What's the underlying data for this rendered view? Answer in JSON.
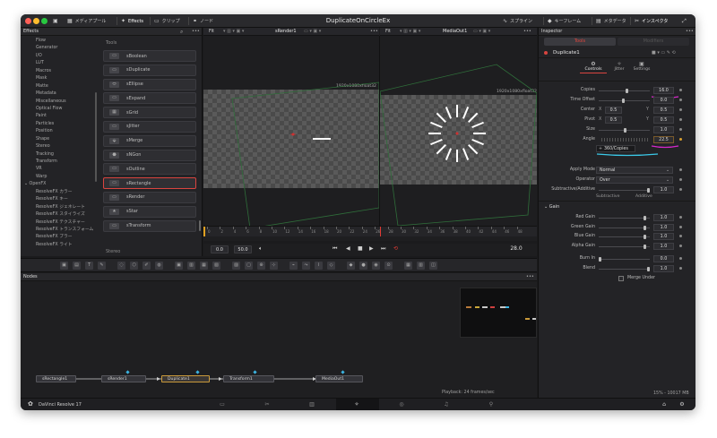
{
  "titlebar": {
    "title": "DuplicateOnCircleEx",
    "left_buttons": [
      {
        "label": "メディアプール",
        "icon": "media-pool-icon"
      },
      {
        "label": "Effects",
        "icon": "effects-icon"
      },
      {
        "label": "クリップ",
        "icon": "clips-icon"
      },
      {
        "label": "ノード",
        "icon": "nodes-icon"
      }
    ],
    "right_buttons": [
      {
        "label": "スプライン",
        "icon": "spline-icon"
      },
      {
        "label": "キーフレーム",
        "icon": "keyframe-icon"
      },
      {
        "label": "メタデータ",
        "icon": "metadata-icon"
      },
      {
        "label": "インスペクタ",
        "icon": "inspector-icon"
      }
    ]
  },
  "effects": {
    "title": "Effects",
    "tree": [
      {
        "label": "Flow",
        "kind": "item"
      },
      {
        "label": "Generator",
        "kind": "item"
      },
      {
        "label": "I/O",
        "kind": "item"
      },
      {
        "label": "LUT",
        "kind": "item"
      },
      {
        "label": "Macros",
        "kind": "item"
      },
      {
        "label": "Mask",
        "kind": "item"
      },
      {
        "label": "Matte",
        "kind": "item"
      },
      {
        "label": "Metadata",
        "kind": "item"
      },
      {
        "label": "Miscellaneous",
        "kind": "item"
      },
      {
        "label": "Optical Flow",
        "kind": "item"
      },
      {
        "label": "Paint",
        "kind": "item"
      },
      {
        "label": "Particles",
        "kind": "item"
      },
      {
        "label": "Position",
        "kind": "item"
      },
      {
        "label": "Shape",
        "kind": "item"
      },
      {
        "label": "Stereo",
        "kind": "item"
      },
      {
        "label": "Tracking",
        "kind": "item"
      },
      {
        "label": "Transform",
        "kind": "item"
      },
      {
        "label": "VR",
        "kind": "item"
      },
      {
        "label": "Warp",
        "kind": "item"
      },
      {
        "label": "OpenFX",
        "kind": "group"
      },
      {
        "label": "ResolveFX カラー",
        "kind": "sub"
      },
      {
        "label": "ResolveFX キー",
        "kind": "sub"
      },
      {
        "label": "ResolveFX ジェネレート",
        "kind": "sub"
      },
      {
        "label": "ResolveFX スタイライズ",
        "kind": "sub"
      },
      {
        "label": "ResolveFX テクスチャー",
        "kind": "sub"
      },
      {
        "label": "ResolveFX トランスフォーム",
        "kind": "sub"
      },
      {
        "label": "ResolveFX ブラー",
        "kind": "sub"
      },
      {
        "label": "ResolveFX ライト",
        "kind": "sub"
      }
    ],
    "tools_label": "Tools",
    "tools": [
      {
        "label": "sBoolean",
        "selected": false
      },
      {
        "label": "sDuplicate",
        "selected": false
      },
      {
        "label": "sEllipse",
        "selected": false
      },
      {
        "label": "sExpand",
        "selected": false
      },
      {
        "label": "sGrid",
        "selected": false
      },
      {
        "label": "sJitter",
        "selected": false
      },
      {
        "label": "sMerge",
        "selected": false
      },
      {
        "label": "sNGon",
        "selected": false
      },
      {
        "label": "sOutline",
        "selected": false
      },
      {
        "label": "sRectangle",
        "selected": true
      },
      {
        "label": "sRender",
        "selected": false
      },
      {
        "label": "sStar",
        "selected": false
      },
      {
        "label": "sTransform",
        "selected": false
      }
    ],
    "stereo_label": "Stereo"
  },
  "viewers": {
    "left": {
      "fit": "Fit",
      "name": "sRender1",
      "resolution": "1920x1080xfloat32"
    },
    "right": {
      "fit": "Fit",
      "name": "MediaOut1",
      "resolution": "1920x1080xfloat32"
    }
  },
  "ruler_ticks": [
    "0",
    "2",
    "4",
    "6",
    "8",
    "10",
    "12",
    "14",
    "16",
    "18",
    "20",
    "22",
    "24",
    "26",
    "28",
    "30",
    "32",
    "34",
    "36",
    "38",
    "40",
    "42",
    "44",
    "46",
    "48"
  ],
  "transport": {
    "start": "0.0",
    "end": "50.0",
    "current": "28.0"
  },
  "nodes": {
    "title": "Nodes",
    "items": [
      "sRectangle1",
      "sRender1",
      "Duplicate1",
      "Transform1",
      "MediaOut1"
    ],
    "status": "Playback: 24 frames/sec"
  },
  "inspector": {
    "title": "Inspector",
    "tabs": [
      "Tools",
      "Modifiers"
    ],
    "node_name": "Duplicate1",
    "subtabs": [
      "Controls",
      "Jitter",
      "Settings"
    ],
    "copies": {
      "label": "Copies",
      "value": "16.0"
    },
    "time_offset": {
      "label": "Time Offset",
      "value": "0.0"
    },
    "center": {
      "label": "Center",
      "x_label": "X",
      "x": "0.5",
      "y_label": "Y",
      "y": "0.5"
    },
    "pivot": {
      "label": "Pivot",
      "x_label": "X",
      "x": "0.5",
      "y_label": "Y",
      "y": "0.5"
    },
    "size": {
      "label": "Size",
      "value": "1.0"
    },
    "angle": {
      "label": "Angle",
      "value": "22.5"
    },
    "expression": "360/Copies",
    "apply_mode": {
      "label": "Apply Mode",
      "value": "Normal"
    },
    "operator": {
      "label": "Operator",
      "value": "Over"
    },
    "sub_add": {
      "label": "Subtractive/Additive",
      "value": "1.0",
      "left": "Subtractive",
      "right": "Additive"
    },
    "gain_section": "Gain",
    "red_gain": {
      "label": "Red Gain",
      "value": "1.0"
    },
    "green_gain": {
      "label": "Green Gain",
      "value": "1.0"
    },
    "blue_gain": {
      "label": "Blue Gain",
      "value": "1.0"
    },
    "alpha_gain": {
      "label": "Alpha Gain",
      "value": "1.0"
    },
    "burn_in": {
      "label": "Burn In",
      "value": "0.0"
    },
    "blend": {
      "label": "Blend",
      "value": "1.0"
    },
    "merge_under": "Merge Under"
  },
  "bottombar": {
    "app": "DaVinci Resolve 17",
    "memory": "15% - 10017 MB"
  },
  "colors": {
    "accent_red": "#d9443f",
    "annotation_magenta": "#d627c9",
    "annotation_cyan": "#3bc9e8",
    "node_active": "#c99a3a"
  }
}
